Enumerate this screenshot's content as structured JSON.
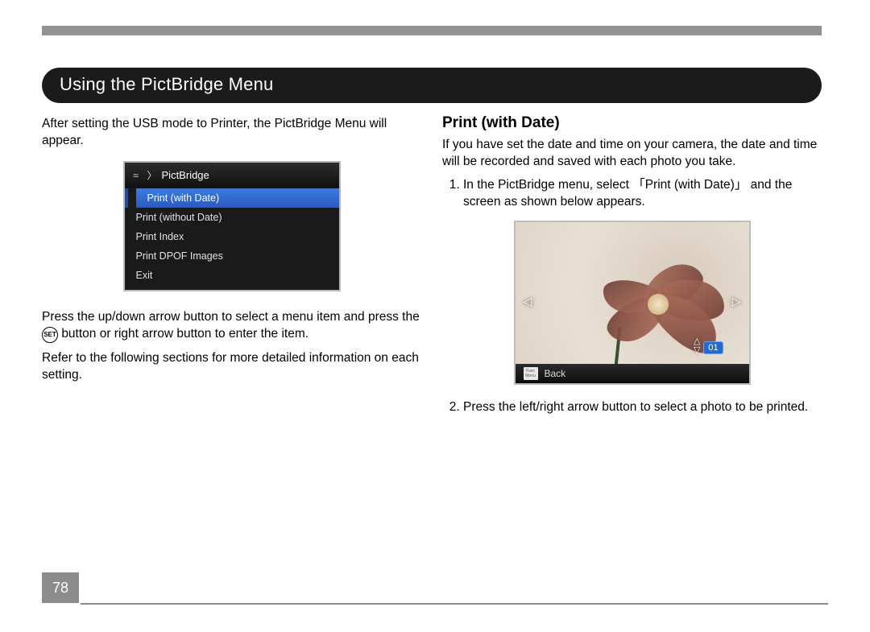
{
  "pill_heading": "Using the PictBridge Menu",
  "left": {
    "intro": "After setting the USB mode to Printer, the PictBridge Menu will appear.",
    "instruction_a": "Press the up/down arrow button to select a menu item and press the ",
    "set_label": "SET",
    "instruction_b": " button or right arrow button to enter the item.",
    "refer": "Refer to the following sections for more detailed information on each setting."
  },
  "menu": {
    "title": "PictBridge",
    "items": [
      "Print (with Date)",
      "Print (without Date)",
      "Print Index",
      "Print DPOF Images",
      "Exit"
    ],
    "selected_index": 0
  },
  "right": {
    "subhead": "Print (with Date)",
    "intro": "If you have set the date and time on your camera, the date and time will be recorded and saved with each photo you take.",
    "steps": {
      "s1": "In the PictBridge menu, select 「Print (with Date)」 and the screen as shown below appears.",
      "s2": "Press the left/right arrow button to select a photo to be printed."
    }
  },
  "preview": {
    "count_badge": "01",
    "back_label": "Back",
    "func_top": "Func",
    "func_bottom": "Menu"
  },
  "page_number": "78"
}
